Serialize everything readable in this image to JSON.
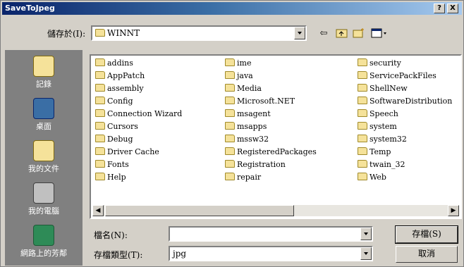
{
  "window": {
    "title": "SaveToJpeg",
    "help_btn": "?",
    "close_btn": "X"
  },
  "toolbar": {
    "save_in_label": "儲存於(I):",
    "current_folder": "WINNT"
  },
  "places": [
    {
      "label": "記錄",
      "icon": "history-icon"
    },
    {
      "label": "桌面",
      "icon": "desktop-icon"
    },
    {
      "label": "我的文件",
      "icon": "my-documents-icon"
    },
    {
      "label": "我的電腦",
      "icon": "my-computer-icon"
    },
    {
      "label": "網路上的芳鄰",
      "icon": "network-places-icon"
    }
  ],
  "folders": {
    "col1": [
      "addins",
      "AppPatch",
      "assembly",
      "Config",
      "Connection Wizard",
      "Cursors",
      "Debug",
      "Driver Cache",
      "Fonts",
      "Help"
    ],
    "col2": [
      "ime",
      "java",
      "Media",
      "Microsoft.NET",
      "msagent",
      "msapps",
      "mssw32",
      "RegisteredPackages",
      "Registration",
      "repair"
    ],
    "col3": [
      "security",
      "ServicePackFiles",
      "ShellNew",
      "SoftwareDistribution",
      "Speech",
      "system",
      "system32",
      "Temp",
      "twain_32",
      "Web"
    ]
  },
  "form": {
    "filename_label": "檔名(N):",
    "filename_value": "",
    "filetype_label": "存檔類型(T):",
    "filetype_value": "jpg",
    "save_button": "存檔(S)",
    "cancel_button": "取消"
  }
}
